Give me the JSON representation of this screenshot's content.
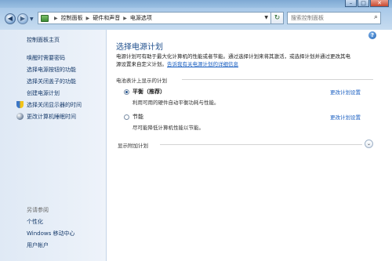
{
  "window": {
    "minimize_glyph": "–",
    "maximize_glyph": "□",
    "close_glyph": "✕"
  },
  "address": {
    "crumbs": [
      "控制面板",
      "硬件和声音",
      "电源选项"
    ],
    "search_placeholder": "搜索控制面板"
  },
  "sidebar": {
    "home": "控制面板主页",
    "items": [
      "唤醒时需要密码",
      "选择电源按钮的功能",
      "选择关闭盖子的功能",
      "创建电源计划",
      "选择关闭显示器的时间",
      "更改计算机睡眠时间"
    ],
    "see_also_title": "另请参阅",
    "see_also": [
      "个性化",
      "Windows 移动中心",
      "用户帐户"
    ]
  },
  "main": {
    "title": "选择电源计划",
    "desc_line1": "电源计划可有助于最大化计算机的性能或者节能。通过选择计划来将其激活，或选择计划并通过更改其电",
    "desc_line2_prefix": "源设置来自定义计划。",
    "desc_link": "告诉我有关电源计划的详细信息",
    "battery_section": "电池表计上显示的计划",
    "plans": [
      {
        "name": "平衡（推荐）",
        "desc": "利用可用的硬件自动平衡功耗与性能。",
        "selected": true
      },
      {
        "name": "节能",
        "desc": "尽可能降低计算机性能以节能。",
        "selected": false
      }
    ],
    "change_link": "更改计划设置",
    "extra_section": "显示附加计划"
  }
}
